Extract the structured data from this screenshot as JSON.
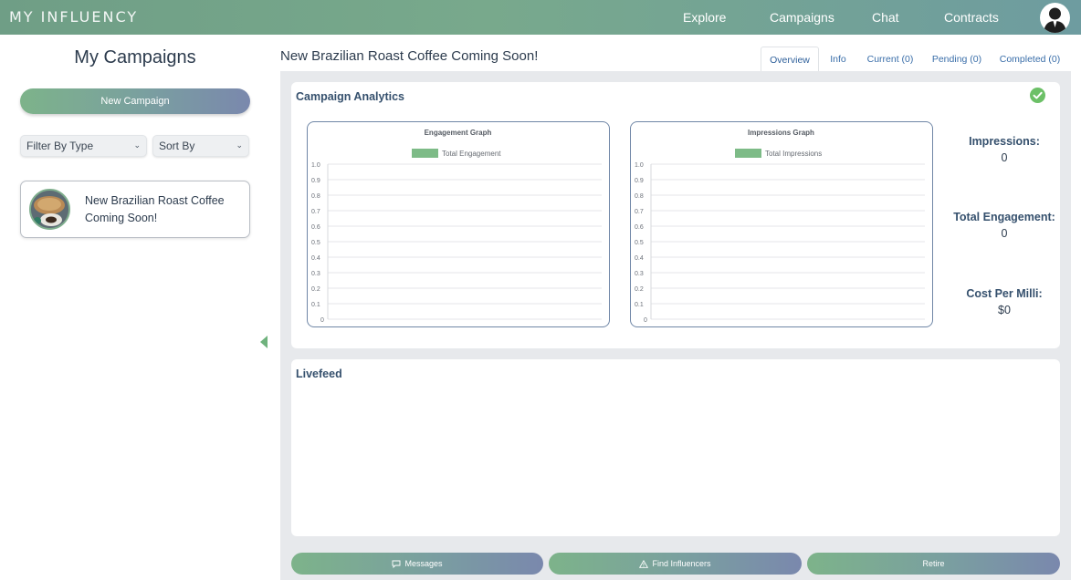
{
  "app": {
    "logo_text": "MY INFLUENCY"
  },
  "nav": {
    "explore": "Explore",
    "campaigns": "Campaigns",
    "chat": "Chat",
    "contracts": "Contracts"
  },
  "sidebar": {
    "title": "My Campaigns",
    "new_campaign_label": "New Campaign",
    "filter_select": "Filter By Type",
    "sort_select": "Sort By",
    "campaigns": [
      {
        "title": "New Brazilian Roast Coffee Coming Soon!"
      }
    ]
  },
  "main": {
    "title": "New Brazilian Roast Coffee Coming Soon!",
    "tabs": [
      "Overview",
      "Info",
      "Current (0)",
      "Pending (0)",
      "Completed (0)"
    ],
    "active_tab": "Overview",
    "analytics_title": "Campaign Analytics",
    "livefeed_title": "Livefeed",
    "stats": [
      {
        "label": "Impressions:",
        "value": "0"
      },
      {
        "label": "Total Engagement:",
        "value": "0"
      },
      {
        "label": "Cost Per Milli:",
        "value": "$0"
      }
    ],
    "buttons": {
      "messages": "Messages",
      "find_influencers": "Find Influencers",
      "retire": "Retire"
    }
  },
  "colors": {
    "accent_green": "#6fae84",
    "series_green": "#7dbb87",
    "check_green": "#6cc067",
    "title_blue": "#35506d"
  },
  "chart_data": [
    {
      "type": "bar",
      "title": "Engagement Graph",
      "series": [
        {
          "name": "Total Engagement",
          "values": []
        }
      ],
      "categories": [],
      "ylim": [
        0,
        1.0
      ],
      "yticks": [
        "0",
        "0.1",
        "0.2",
        "0.3",
        "0.4",
        "0.5",
        "0.6",
        "0.7",
        "0.8",
        "0.9",
        "1.0"
      ],
      "grid": true,
      "legend": "top"
    },
    {
      "type": "bar",
      "title": "Impressions Graph",
      "series": [
        {
          "name": "Total Impressions",
          "values": []
        }
      ],
      "categories": [],
      "ylim": [
        0,
        1.0
      ],
      "yticks": [
        "0",
        "0.1",
        "0.2",
        "0.3",
        "0.4",
        "0.5",
        "0.6",
        "0.7",
        "0.8",
        "0.9",
        "1.0"
      ],
      "grid": true,
      "legend": "top"
    }
  ]
}
